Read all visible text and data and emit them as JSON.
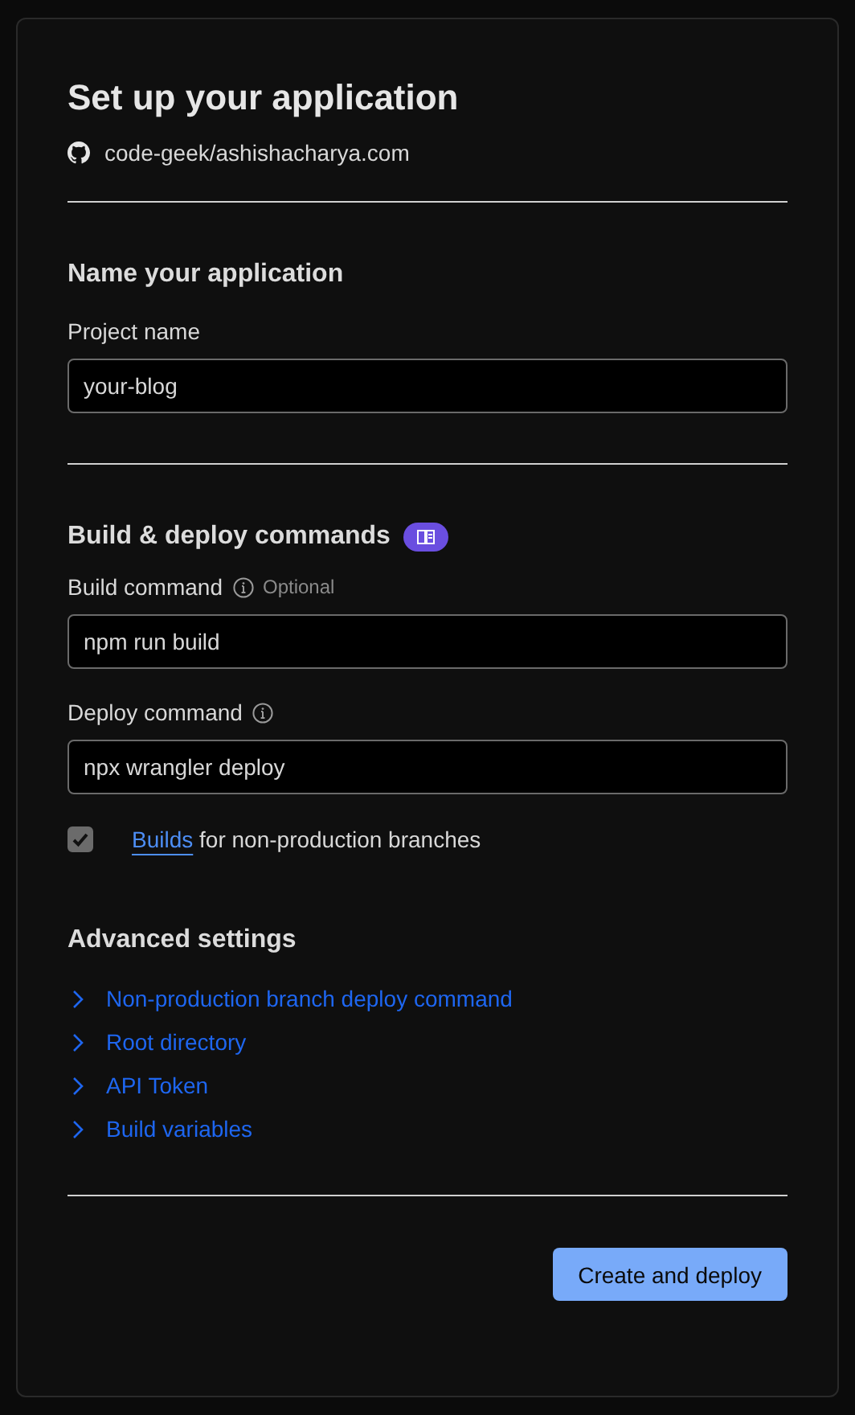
{
  "title": "Set up your application",
  "repository": "code-geek/ashishacharya.com",
  "name_section": {
    "heading": "Name your application",
    "field": {
      "label": "Project name",
      "value": "your-blog"
    }
  },
  "build_section": {
    "heading": "Build & deploy commands",
    "fields": [
      {
        "label": "Build command",
        "info": true,
        "optional": "Optional",
        "value": "npm run build"
      },
      {
        "label": "Deploy command",
        "info": true,
        "value": "npx wrangler deploy"
      }
    ],
    "checkbox": {
      "link": "Builds",
      "label": "for non-production branches",
      "checked": true
    }
  },
  "advanced": {
    "heading": "Advanced settings",
    "items": [
      {
        "label": "Non-production branch deploy command",
        "expanded": false
      },
      {
        "label": "Root directory",
        "expanded": false
      },
      {
        "label": "API Token",
        "expanded": false
      },
      {
        "label": "Build variables",
        "expanded": false
      }
    ]
  },
  "button": "Create and deploy"
}
